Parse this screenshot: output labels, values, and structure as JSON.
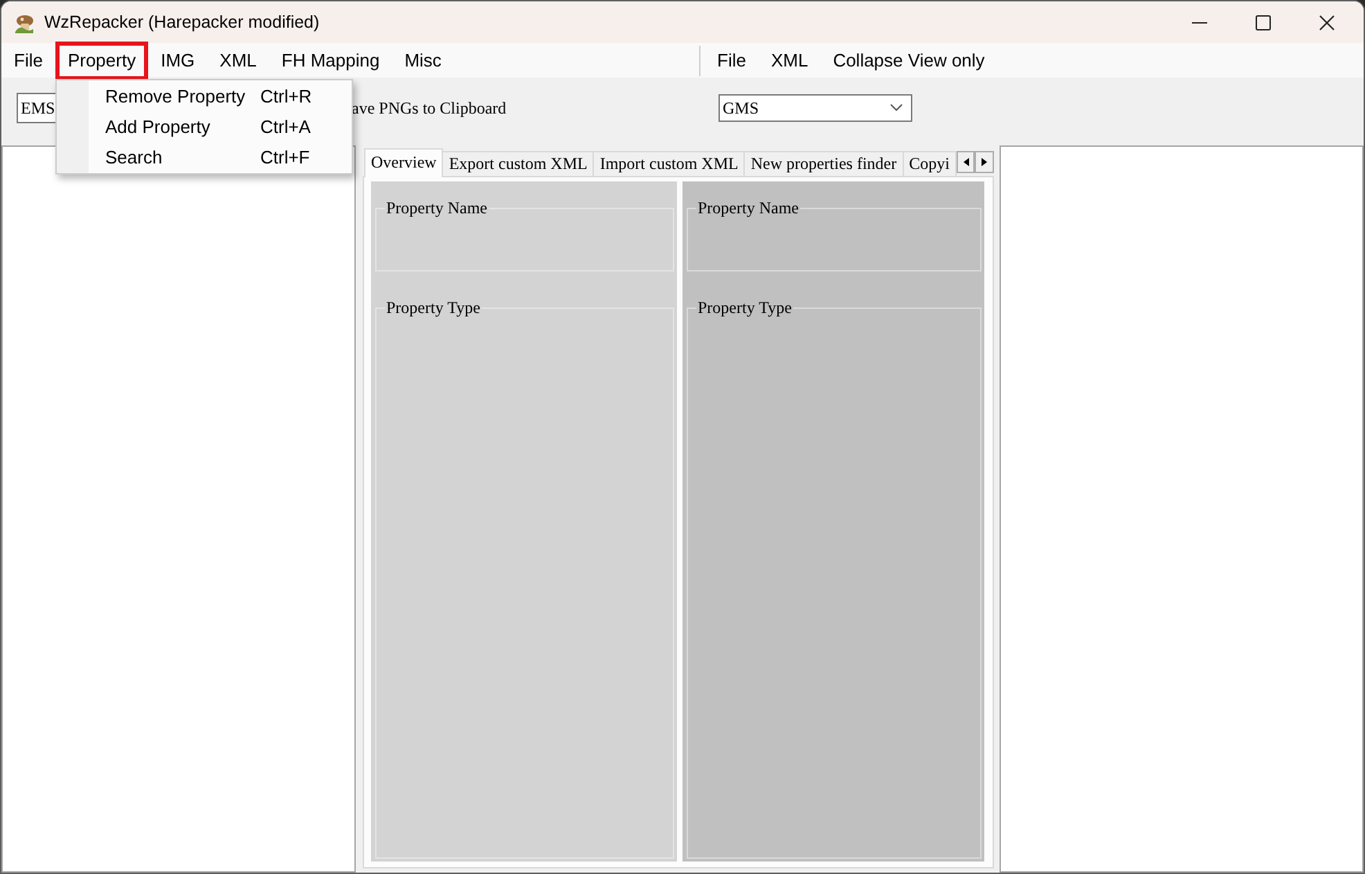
{
  "window": {
    "title": "WzRepacker (Harepacker modified)"
  },
  "menu_bar": {
    "left": [
      {
        "label": "File",
        "selected": false
      },
      {
        "label": "Property",
        "selected": true
      },
      {
        "label": "IMG",
        "selected": false
      },
      {
        "label": "XML",
        "selected": false
      },
      {
        "label": "FH Mapping",
        "selected": false
      },
      {
        "label": "Misc",
        "selected": false
      }
    ],
    "right": [
      {
        "label": "File",
        "selected": false
      },
      {
        "label": "XML",
        "selected": false
      },
      {
        "label": "Collapse View only",
        "selected": false
      }
    ]
  },
  "dropdown_menu": {
    "items": [
      {
        "label": "Remove Property",
        "shortcut": "Ctrl+R"
      },
      {
        "label": "Add Property",
        "shortcut": "Ctrl+A"
      },
      {
        "label": "Search",
        "shortcut": "Ctrl+F"
      }
    ]
  },
  "toolbar": {
    "region_combo": {
      "value": "EMS"
    },
    "checkbox_label": "ave PNGs to Clipboard",
    "version_combo": {
      "value": "GMS"
    }
  },
  "tabs": [
    {
      "label": "Overview",
      "selected": true
    },
    {
      "label": "Export custom XML",
      "selected": false
    },
    {
      "label": "Import custom XML",
      "selected": false
    },
    {
      "label": "New properties finder",
      "selected": false
    },
    {
      "label": "Copyi",
      "selected": false
    }
  ],
  "panels": [
    {
      "groups": [
        {
          "label": "Property Name"
        },
        {
          "label": "Property Type"
        }
      ]
    },
    {
      "groups": [
        {
          "label": "Property Name"
        },
        {
          "label": "Property Type"
        }
      ]
    }
  ]
}
